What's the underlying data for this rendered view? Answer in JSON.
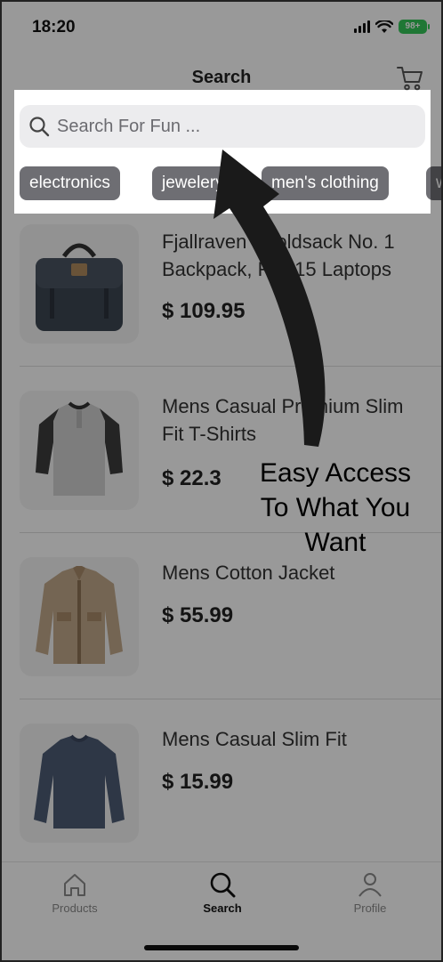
{
  "status_bar": {
    "time": "18:20",
    "battery": "98+"
  },
  "header": {
    "title": "Search"
  },
  "search": {
    "placeholder": "Search For Fun ..."
  },
  "categories": [
    "electronics",
    "jewelery",
    "men's clothing",
    "women's clothing"
  ],
  "products": [
    {
      "name": "Fjallraven - Foldsack No. 1 Backpack, Fits 15 Laptops",
      "price": "$ 109.95",
      "icon": "backpack-image"
    },
    {
      "name": "Mens Casual Premium Slim Fit T-Shirts",
      "price": "$ 22.3",
      "icon": "tshirt-image"
    },
    {
      "name": "Mens Cotton Jacket",
      "price": "$ 55.99",
      "icon": "jacket-image"
    },
    {
      "name": "Mens Casual Slim Fit",
      "price": "$ 15.99",
      "icon": "longsleeve-image"
    }
  ],
  "tabs": [
    {
      "label": "Products",
      "icon": "home-icon",
      "active": false
    },
    {
      "label": "Search",
      "icon": "search-icon",
      "active": true
    },
    {
      "label": "Profile",
      "icon": "person-icon",
      "active": false
    }
  ],
  "overlay": {
    "line1": "Easy Access",
    "line2": "To What You",
    "line3": "Want",
    "dim_color": "#000000",
    "dim_opacity": 0.4
  },
  "colors": {
    "chip": "#6e6e73",
    "search_bg": "#ececee",
    "battery": "#34c759"
  }
}
